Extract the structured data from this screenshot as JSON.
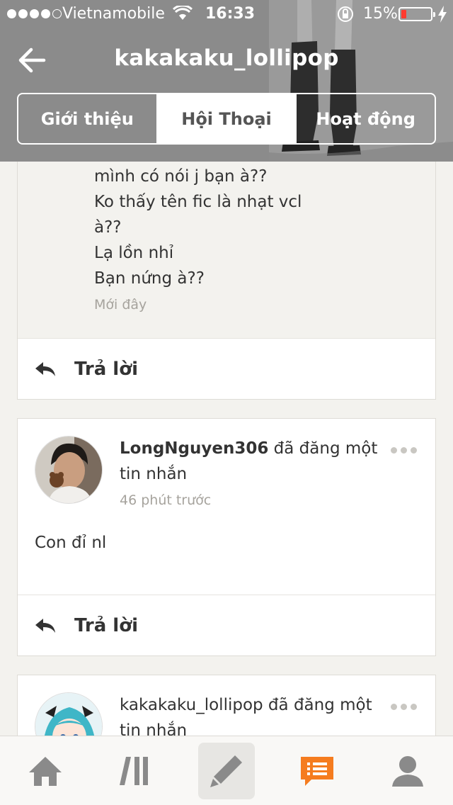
{
  "status_bar": {
    "carrier": "Vietnamobile",
    "time": "16:33",
    "battery": "15%"
  },
  "header": {
    "title": "kakakaku_lollipop",
    "tabs": [
      {
        "label": "Giới thiệu",
        "active": false
      },
      {
        "label": "Hội Thoại",
        "active": true
      },
      {
        "label": "Hoạt động",
        "active": false
      }
    ]
  },
  "feed": {
    "first": {
      "lines": [
        "mình có nói j bạn à??",
        "Ko thấy tên fic là nhạt vcl",
        "à??",
        "Lạ lồn nhỉ",
        "Bạn nứng à??"
      ],
      "time": "Mới đây",
      "reply_label": "Trả lời"
    },
    "second": {
      "username": "LongNguyen306",
      "action": " đã đăng một tin nhắn",
      "time": "46 phút trước",
      "body": "Con đỉ nl",
      "reply_label": "Trả lời"
    },
    "third": {
      "username": "kakakaku_lollipop",
      "action": " đã đăng một tin nhắn"
    }
  },
  "tabbar": {
    "icons": [
      "home-icon",
      "library-icon",
      "compose-icon",
      "conversations-icon",
      "profile-icon"
    ]
  },
  "colors": {
    "header_bg": "#8b8b8b",
    "accent": "#f57c1f",
    "page_bg": "#f3f2ee"
  }
}
